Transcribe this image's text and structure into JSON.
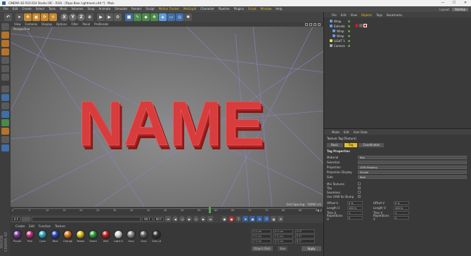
{
  "titlebar": {
    "title": "CINEMA 4D R19.024 Studio (RC - R19) - [Papa Bear Lightroom.c4d *] - Main",
    "controls": [
      "—",
      "☐",
      "✕"
    ]
  },
  "menu": [
    "File",
    "Edit",
    "Create",
    "Select",
    "Tools",
    "Mesh",
    "Volumes",
    "Snap",
    "Animate",
    "Simulate",
    "Render",
    "Sculpt",
    "Motion Tracker",
    "MoGraph",
    "Character",
    "Pipeline",
    "Plugins",
    "Script",
    "Window",
    "Help"
  ],
  "layout": {
    "label": "Layout:",
    "value": "Startup"
  },
  "viewport": {
    "menu": [
      "View",
      "Cameras",
      "Display",
      "Options",
      "Filter",
      "Panel",
      "ProRender"
    ],
    "label": "Perspective",
    "text3d": "NAME",
    "grid_spacing": "Grid Spacing : 10000 cm"
  },
  "timeline": {
    "ticks": [
      "0",
      "5",
      "10",
      "15",
      "20",
      "25",
      "30",
      "35",
      "40",
      "45",
      "50",
      "55",
      "60",
      "65",
      "70",
      "75",
      "80",
      "85",
      "90"
    ],
    "frame": "0 F",
    "playhead_frame": 58
  },
  "transport": {
    "start": "0 F",
    "current": "0 F",
    "end": "90 F",
    "end2": "90 F"
  },
  "materials": {
    "menu": [
      "Create",
      "Edit",
      "Function",
      "Texture"
    ],
    "items": [
      {
        "name": "Purple",
        "color": "#7a3a9a"
      },
      {
        "name": "Pink",
        "color": "#c0307a"
      },
      {
        "name": "Cyan",
        "color": "#30a8c8"
      },
      {
        "name": "Blue",
        "color": "#2848b8"
      },
      {
        "name": "Orange",
        "color": "#d87820"
      },
      {
        "name": "Yellow",
        "color": "#d8c020"
      },
      {
        "name": "Green",
        "color": "#30a040"
      },
      {
        "name": "Red",
        "color": "#c02020"
      },
      {
        "name": "Light G",
        "color": "#d8d8d8"
      },
      {
        "name": "Grey",
        "color": "#888888"
      },
      {
        "name": "Grey",
        "color": "#606060"
      },
      {
        "name": "Grey (d",
        "color": "#383838"
      }
    ]
  },
  "coords": {
    "rows": [
      [
        "X 0 cm",
        "X 0 cm",
        "H 0°"
      ],
      [
        "Y 0 cm",
        "Y 0 cm",
        "P 0°"
      ],
      [
        "Z 0 cm",
        "Z 0 cm",
        "B 0°"
      ]
    ],
    "mode": "Object (Rel)",
    "size": "Size",
    "apply": "Apply"
  },
  "objects": {
    "menu": [
      "File",
      "Edit",
      "View",
      "Objects",
      "Tags",
      "Bookmarks"
    ],
    "items": [
      {
        "name": "Wrap",
        "indent": 0,
        "color": "#6a9ad8"
      },
      {
        "name": "Extrude",
        "indent": 0,
        "color": "#6a9ad8"
      },
      {
        "name": "Wrap",
        "indent": 1,
        "color": "#6a9ad8"
      },
      {
        "name": "Wrap",
        "indent": 1,
        "color": "#6a9ad8"
      },
      {
        "name": "LIGHT 1",
        "indent": 0,
        "color": "#e8e060"
      },
      {
        "name": "Camera",
        "indent": 0,
        "color": "#aaaaaa"
      }
    ]
  },
  "attributes": {
    "menu": [
      "Mode",
      "Edit",
      "User Data"
    ],
    "tag_title": "Texture Tag [Texture]",
    "tabs": [
      "Basic",
      "Tag",
      "Coordinates"
    ],
    "active_tab": "Tag",
    "section": "Tag Properties",
    "rows": [
      {
        "label": "Material",
        "value": "Red"
      },
      {
        "label": "Selection",
        "value": ""
      },
      {
        "label": "Projection",
        "value": "UVW Mapping"
      },
      {
        "label": "Projection Display",
        "value": "Simple"
      },
      {
        "label": "Side",
        "value": "Both"
      }
    ],
    "checks": [
      {
        "label": "Mix Textures",
        "checked": false
      },
      {
        "label": "Tile",
        "checked": true
      },
      {
        "label": "Seamless",
        "checked": false
      },
      {
        "label": "Use UVW for Bump",
        "checked": true
      }
    ],
    "pairs": [
      {
        "l1": "Offset U",
        "v1": "0 %",
        "l2": "Offset V",
        "v2": "0 %"
      },
      {
        "l1": "Length U",
        "v1": "100 %",
        "l2": "Length V",
        "v2": "100 %"
      },
      {
        "l1": "Tiles U",
        "v1": "1",
        "l2": "Tiles V",
        "v2": "1"
      },
      {
        "l1": "Repetitions U",
        "v1": "0",
        "l2": "Repetitions V",
        "v2": "0"
      }
    ]
  },
  "side_label": "MAXON CINEMA 4D",
  "colors": {
    "text_red": "#d43a3a",
    "text_red_dark": "#8a1616",
    "accent": "#e8c020"
  }
}
